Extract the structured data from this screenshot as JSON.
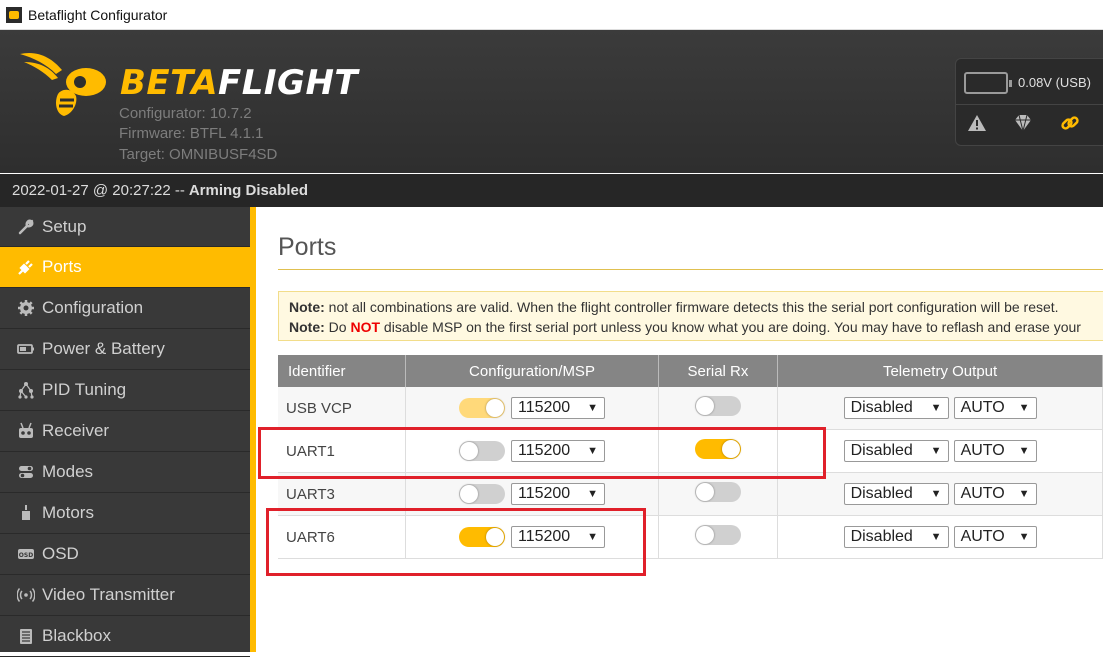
{
  "window": {
    "title": "Betaflight Configurator"
  },
  "header": {
    "brand_part1": "BETA",
    "brand_part2": "FLIGHT",
    "configurator": "Configurator: 10.7.2",
    "firmware": "Firmware: BTFL 4.1.1",
    "target": "Target: OMNIBUSF4SD",
    "voltage": "0.08V (USB)"
  },
  "statusbar": {
    "datetime": "2022-01-27 @ 20:27:22 --",
    "arming": "Arming Disabled"
  },
  "sidebar": {
    "items": [
      {
        "label": "Setup",
        "icon": "wrench-icon"
      },
      {
        "label": "Ports",
        "icon": "plug-icon",
        "active": true
      },
      {
        "label": "Configuration",
        "icon": "gear-icon"
      },
      {
        "label": "Power & Battery",
        "icon": "battery-icon"
      },
      {
        "label": "PID Tuning",
        "icon": "pid-icon"
      },
      {
        "label": "Receiver",
        "icon": "receiver-icon"
      },
      {
        "label": "Modes",
        "icon": "modes-icon"
      },
      {
        "label": "Motors",
        "icon": "motor-icon"
      },
      {
        "label": "OSD",
        "icon": "osd-icon"
      },
      {
        "label": "Video Transmitter",
        "icon": "antenna-icon"
      },
      {
        "label": "Blackbox",
        "icon": "blackbox-icon"
      }
    ]
  },
  "main": {
    "title": "Ports",
    "note1_label": "Note:",
    "note1_text": " not all combinations are valid. When the flight controller firmware detects this the serial port configuration will be reset.",
    "note2_label": "Note:",
    "note2_pre": " Do ",
    "note2_not": "NOT",
    "note2_post": " disable MSP on the first serial port unless you know what you are doing. You may have to reflash and erase your"
  },
  "table": {
    "headers": [
      "Identifier",
      "Configuration/MSP",
      "Serial Rx",
      "Telemetry Output"
    ],
    "rows": [
      {
        "id": "USB VCP",
        "msp_on": true,
        "msp_faded": true,
        "baud": "115200",
        "rx_on": false,
        "telemetry": "Disabled",
        "telem_baud": "AUTO"
      },
      {
        "id": "UART1",
        "msp_on": false,
        "baud": "115200",
        "rx_on": true,
        "telemetry": "Disabled",
        "telem_baud": "AUTO"
      },
      {
        "id": "UART3",
        "msp_on": false,
        "baud": "115200",
        "rx_on": false,
        "telemetry": "Disabled",
        "telem_baud": "AUTO"
      },
      {
        "id": "UART6",
        "msp_on": true,
        "baud": "115200",
        "rx_on": false,
        "telemetry": "Disabled",
        "telem_baud": "AUTO"
      }
    ]
  },
  "colors": {
    "accent": "#ffbb00",
    "highlight": "#e0202a",
    "sidebar_bg": "#393939",
    "header_bg": "#333333"
  }
}
